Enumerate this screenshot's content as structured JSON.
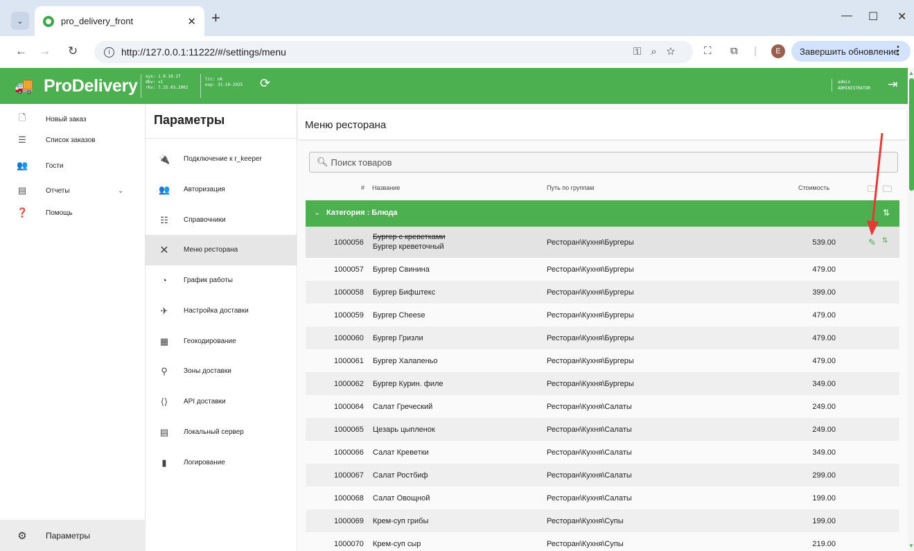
{
  "browser": {
    "tab_title": "pro_delivery_front",
    "url": "http://127.0.0.1:11222/#/settings/menu",
    "profile_initial": "E",
    "update_label": "Завершить обновление"
  },
  "app": {
    "brand": "ProDelivery",
    "version": {
      "sys": "sys: 1.0.10.27",
      "dbv": "dbv: v1",
      "rkv": "rkv: 7.25.03.2002",
      "lic": "lic: ok",
      "exp": "exp: 31-10-2025"
    },
    "user": {
      "login": "admin",
      "role": "ADMINISTRATOR"
    }
  },
  "sidebar": {
    "items": [
      {
        "label": "Новый заказ",
        "icon": "new-order-icon"
      },
      {
        "label": "Список заказов",
        "icon": "order-list-icon"
      },
      {
        "label": "Гости",
        "icon": "guests-icon"
      },
      {
        "label": "Отчеты",
        "icon": "reports-icon"
      },
      {
        "label": "Помощь",
        "icon": "help-icon"
      }
    ],
    "bottom": {
      "label": "Параметры",
      "icon": "gear-icon"
    }
  },
  "settings": {
    "title": "Параметры",
    "items": [
      {
        "label": "Подключение к r_keeper",
        "icon": "plug-icon"
      },
      {
        "label": "Авторизация",
        "icon": "users-icon"
      },
      {
        "label": "Справочники",
        "icon": "list-icon"
      },
      {
        "label": "Меню ресторана",
        "icon": "cutlery-icon"
      },
      {
        "label": "График работы",
        "icon": "clock-icon"
      },
      {
        "label": "Настройка доставки",
        "icon": "delivery-settings-icon"
      },
      {
        "label": "Геокодирование",
        "icon": "geocoding-icon"
      },
      {
        "label": "Зоны доставки",
        "icon": "zone-pin-icon"
      },
      {
        "label": "API доставки",
        "icon": "api-icon"
      },
      {
        "label": "Локальный сервер",
        "icon": "server-icon"
      },
      {
        "label": "Логирование",
        "icon": "log-icon"
      }
    ],
    "active_index": 3
  },
  "main": {
    "title": "Меню ресторана",
    "search_placeholder": "Поиск товаров",
    "columns": {
      "num": "#",
      "name": "Название",
      "path": "Путь по группам",
      "price": "Стоимость"
    },
    "category": "Категория : Блюда",
    "first_row": {
      "id": "1000056",
      "old_name": "Бургер с креветками",
      "new_name": "Бургер креветочный",
      "path": "Ресторан\\Кухня\\Бургеры",
      "price": "539.00"
    },
    "rows": [
      {
        "id": "1000057",
        "name": "Бургер Свинина",
        "path": "Ресторан\\Кухня\\Бургеры",
        "price": "479.00"
      },
      {
        "id": "1000058",
        "name": "Бургер Бифштекс",
        "path": "Ресторан\\Кухня\\Бургеры",
        "price": "399.00"
      },
      {
        "id": "1000059",
        "name": "Бургер Cheese",
        "path": "Ресторан\\Кухня\\Бургеры",
        "price": "479.00"
      },
      {
        "id": "1000060",
        "name": "Бургер Гризли",
        "path": "Ресторан\\Кухня\\Бургеры",
        "price": "479.00"
      },
      {
        "id": "1000061",
        "name": "Бургер Халапеньо",
        "path": "Ресторан\\Кухня\\Бургеры",
        "price": "479.00"
      },
      {
        "id": "1000062",
        "name": "Бургер Курин. филе",
        "path": "Ресторан\\Кухня\\Бургеры",
        "price": "349.00"
      },
      {
        "id": "1000064",
        "name": "Салат Греческий",
        "path": "Ресторан\\Кухня\\Салаты",
        "price": "249.00"
      },
      {
        "id": "1000065",
        "name": "Цезарь цыпленок",
        "path": "Ресторан\\Кухня\\Салаты",
        "price": "249.00"
      },
      {
        "id": "1000066",
        "name": "Салат Креветки",
        "path": "Ресторан\\Кухня\\Салаты",
        "price": "349.00"
      },
      {
        "id": "1000067",
        "name": "Салат Ростбиф",
        "path": "Ресторан\\Кухня\\Салаты",
        "price": "299.00"
      },
      {
        "id": "1000068",
        "name": "Салат Овощной",
        "path": "Ресторан\\Кухня\\Салаты",
        "price": "199.00"
      },
      {
        "id": "1000069",
        "name": "Крем-суп грибы",
        "path": "Ресторан\\Кухня\\Супы",
        "price": "199.00"
      },
      {
        "id": "1000070",
        "name": "Крем-суп сыр",
        "path": "Ресторан\\Кухня\\Супы",
        "price": "219.00"
      }
    ]
  },
  "colors": {
    "accent": "#4caf50",
    "annotation": "#e53935"
  }
}
